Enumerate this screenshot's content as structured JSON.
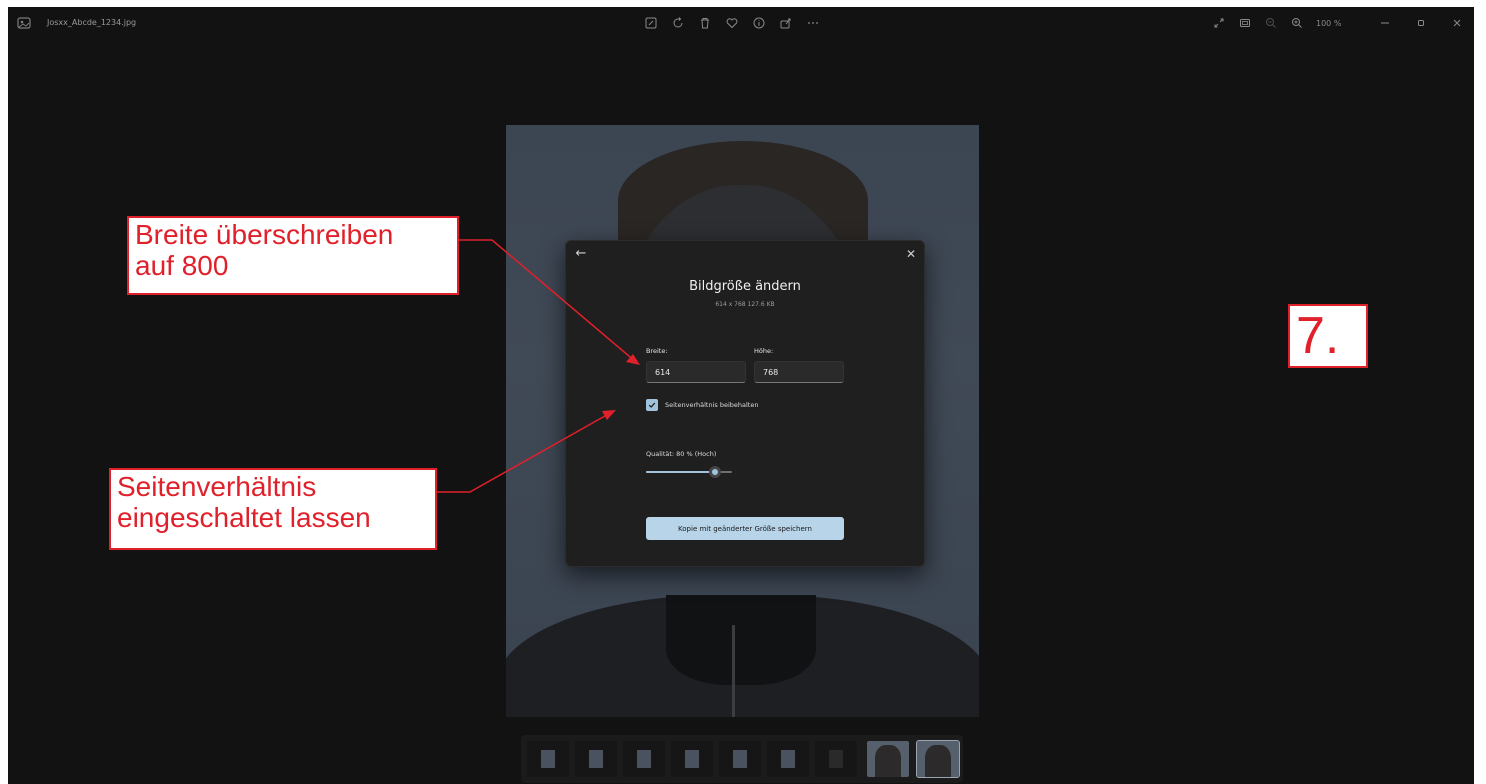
{
  "window": {
    "filename": "Josxx_Abcde_1234.jpg",
    "zoom_level": "100 %"
  },
  "toolbar": {
    "icons": [
      "edit-image-icon",
      "rotate-icon",
      "delete-icon",
      "favorite-heart-icon",
      "info-icon",
      "share-icon",
      "more-options-icon"
    ],
    "right_icons": [
      "fullscreen-icon",
      "fit-to-window-icon",
      "zoom-out-icon",
      "zoom-in-icon"
    ],
    "window_controls": [
      "minimize-icon",
      "restore-icon",
      "close-window-icon"
    ]
  },
  "dialog": {
    "title": "Bildgröße ändern",
    "subtitle": "614 x 768   127.6 KB",
    "width_label": "Breite:",
    "width_value": "614",
    "height_label": "Höhe:",
    "height_value": "768",
    "aspect_label": "Seitenverhältnis beibehalten",
    "aspect_checked": true,
    "quality_label": "Qualität: 80 % (Hoch)",
    "quality_value": 80,
    "save_button": "Kopie mit geänderter Größe speichern"
  },
  "filmstrip": {
    "count": 9,
    "selected_index": 8
  },
  "annotations": {
    "callout_width": [
      "Breite überschreiben",
      "auf 800"
    ],
    "callout_aspect": [
      "Seitenverhältnis",
      "eingeschaltet lassen"
    ],
    "step_number": "7."
  },
  "colors": {
    "accent": "#b7d4e8",
    "annotation": "#e0202a",
    "background": "#121212",
    "dialog": "#1f1f1f"
  }
}
